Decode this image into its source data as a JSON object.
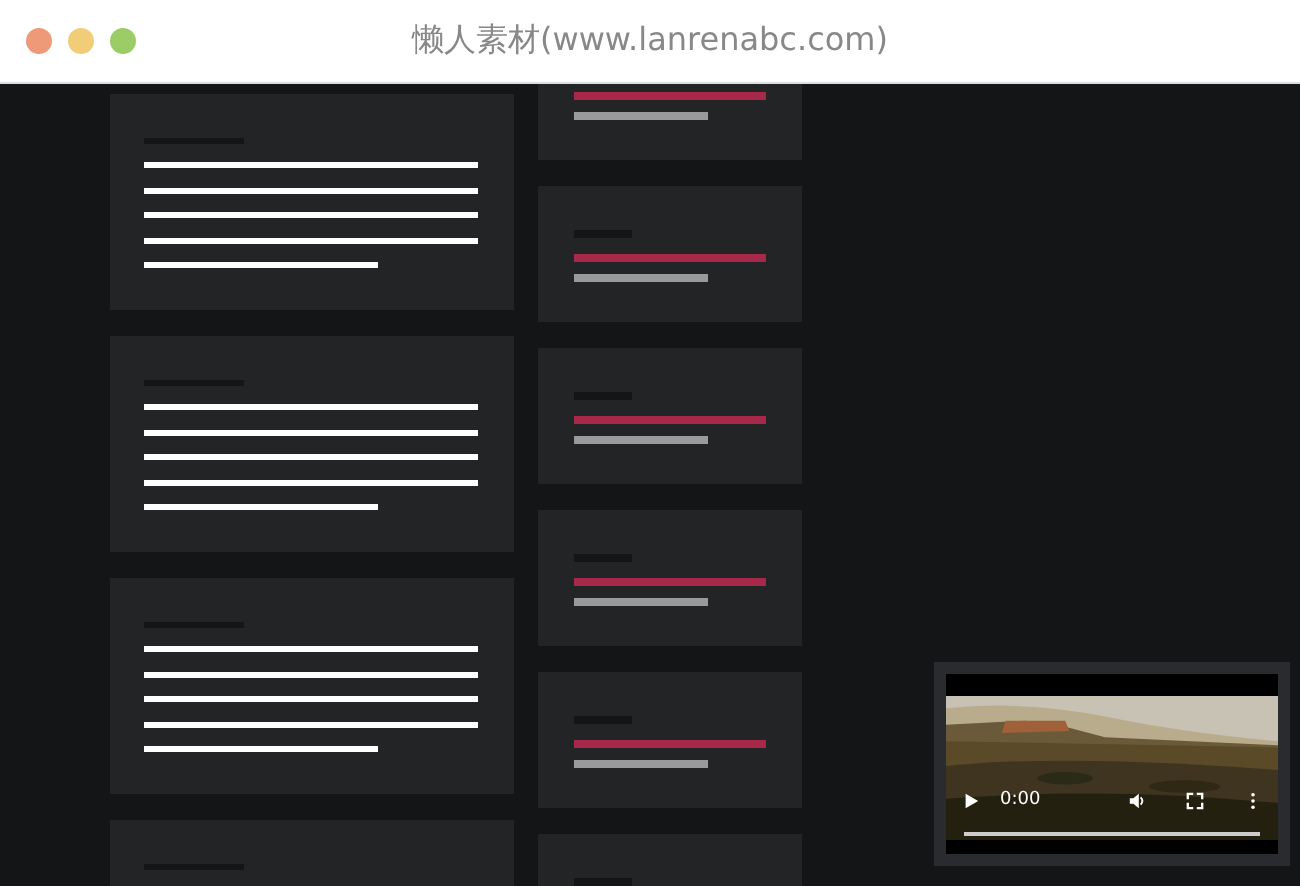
{
  "window": {
    "title": "懒人素材(www.lanrenabc.com)"
  },
  "main_cards": [
    {
      "kind": "skeleton"
    },
    {
      "kind": "skeleton"
    },
    {
      "kind": "skeleton"
    },
    {
      "kind": "skeleton"
    }
  ],
  "side_cards": [
    {
      "kind": "skeleton"
    },
    {
      "kind": "skeleton"
    },
    {
      "kind": "skeleton"
    },
    {
      "kind": "skeleton"
    },
    {
      "kind": "skeleton"
    },
    {
      "kind": "skeleton"
    }
  ],
  "video": {
    "time": "0:00",
    "level": 0
  }
}
